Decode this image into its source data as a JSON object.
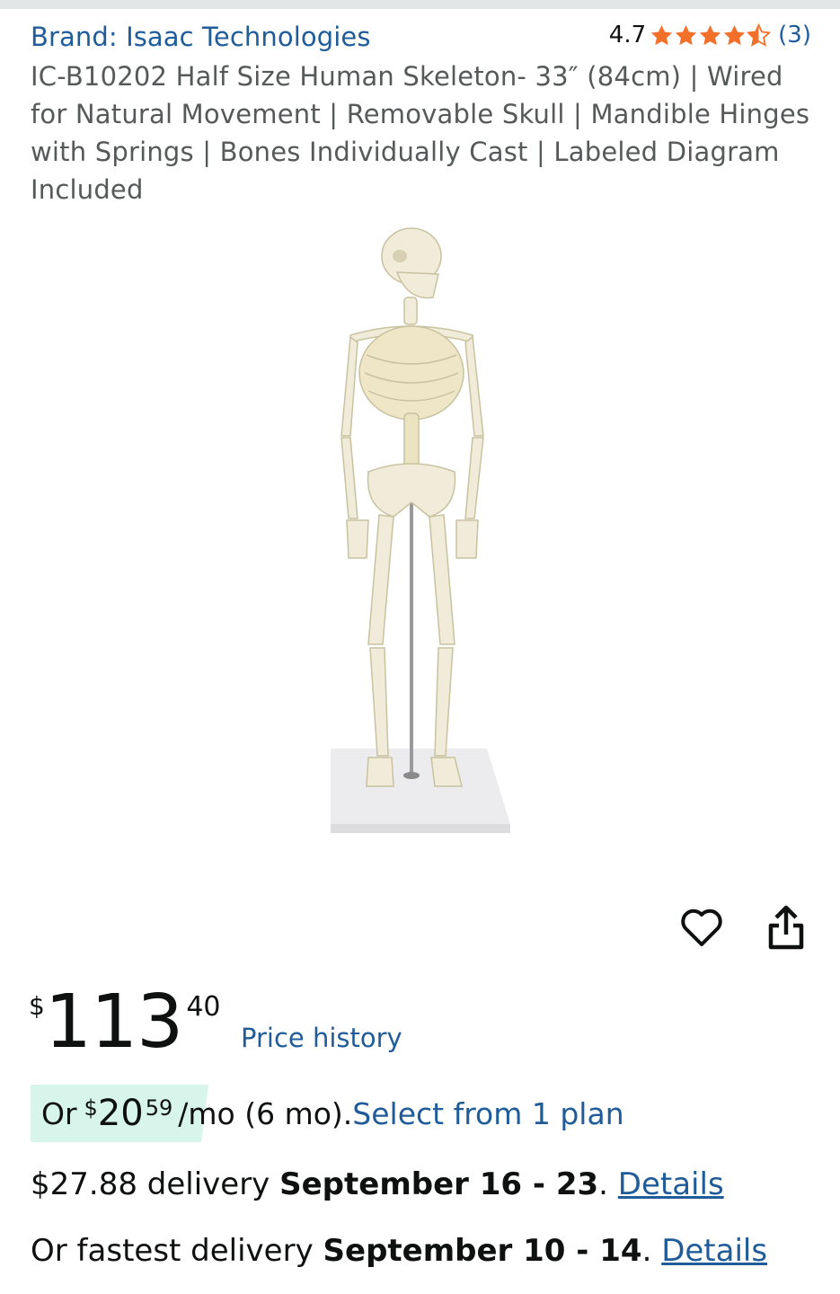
{
  "product": {
    "brand_link": "Brand: Isaac Technologies",
    "rating_value": "4.7",
    "rating_stars": 4.7,
    "rating_count": "(3)",
    "title": "IC-B10202 Half Size Human Skeleton- 33″ (84cm) | Wired for Natural Movement | Removable Skull | Mandible Hinges with Springs | Bones Individually Cast | Labeled Diagram Included"
  },
  "actions": {
    "favorite_icon": "heart-outline-icon",
    "share_icon": "share-icon"
  },
  "price": {
    "symbol": "$",
    "whole": "113",
    "fraction": "40",
    "history_link": "Price history"
  },
  "installment": {
    "prefix": "Or",
    "symbol": "$",
    "whole": "20",
    "fraction": "59",
    "period": "/mo (6 mo).",
    "plan_link": "Select from 1 plan"
  },
  "delivery": {
    "standard_prefix": "$27.88 delivery",
    "standard_dates": "September 16 - 23",
    "standard_dot": ".",
    "standard_link": "Details",
    "fastest_prefix": "Or fastest delivery",
    "fastest_dates": "September 10 - 14",
    "fastest_dot": ".",
    "fastest_link": "Details"
  },
  "colors": {
    "link": "#1f5c99",
    "star": "#f3702a",
    "installment_bg": "#d7f5ea",
    "title_text": "#565959"
  }
}
